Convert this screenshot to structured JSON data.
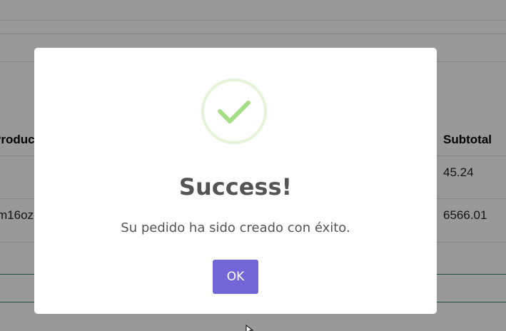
{
  "background_table": {
    "headers": [
      "Producto",
      "Subtotal"
    ],
    "rows": [
      {
        "product": "",
        "subtotal": "45.24"
      },
      {
        "product": "m16oz",
        "subtotal": "6566.01"
      }
    ]
  },
  "dialog": {
    "icon": "check-circle-icon",
    "title": "Success!",
    "message": "Su pedido ha sido creado con éxito.",
    "ok_label": "OK"
  },
  "colors": {
    "overlay": "rgba(0,0,0,0.4)",
    "success_green": "#a5dc86",
    "button": "#7367d8",
    "text": "#545454"
  }
}
